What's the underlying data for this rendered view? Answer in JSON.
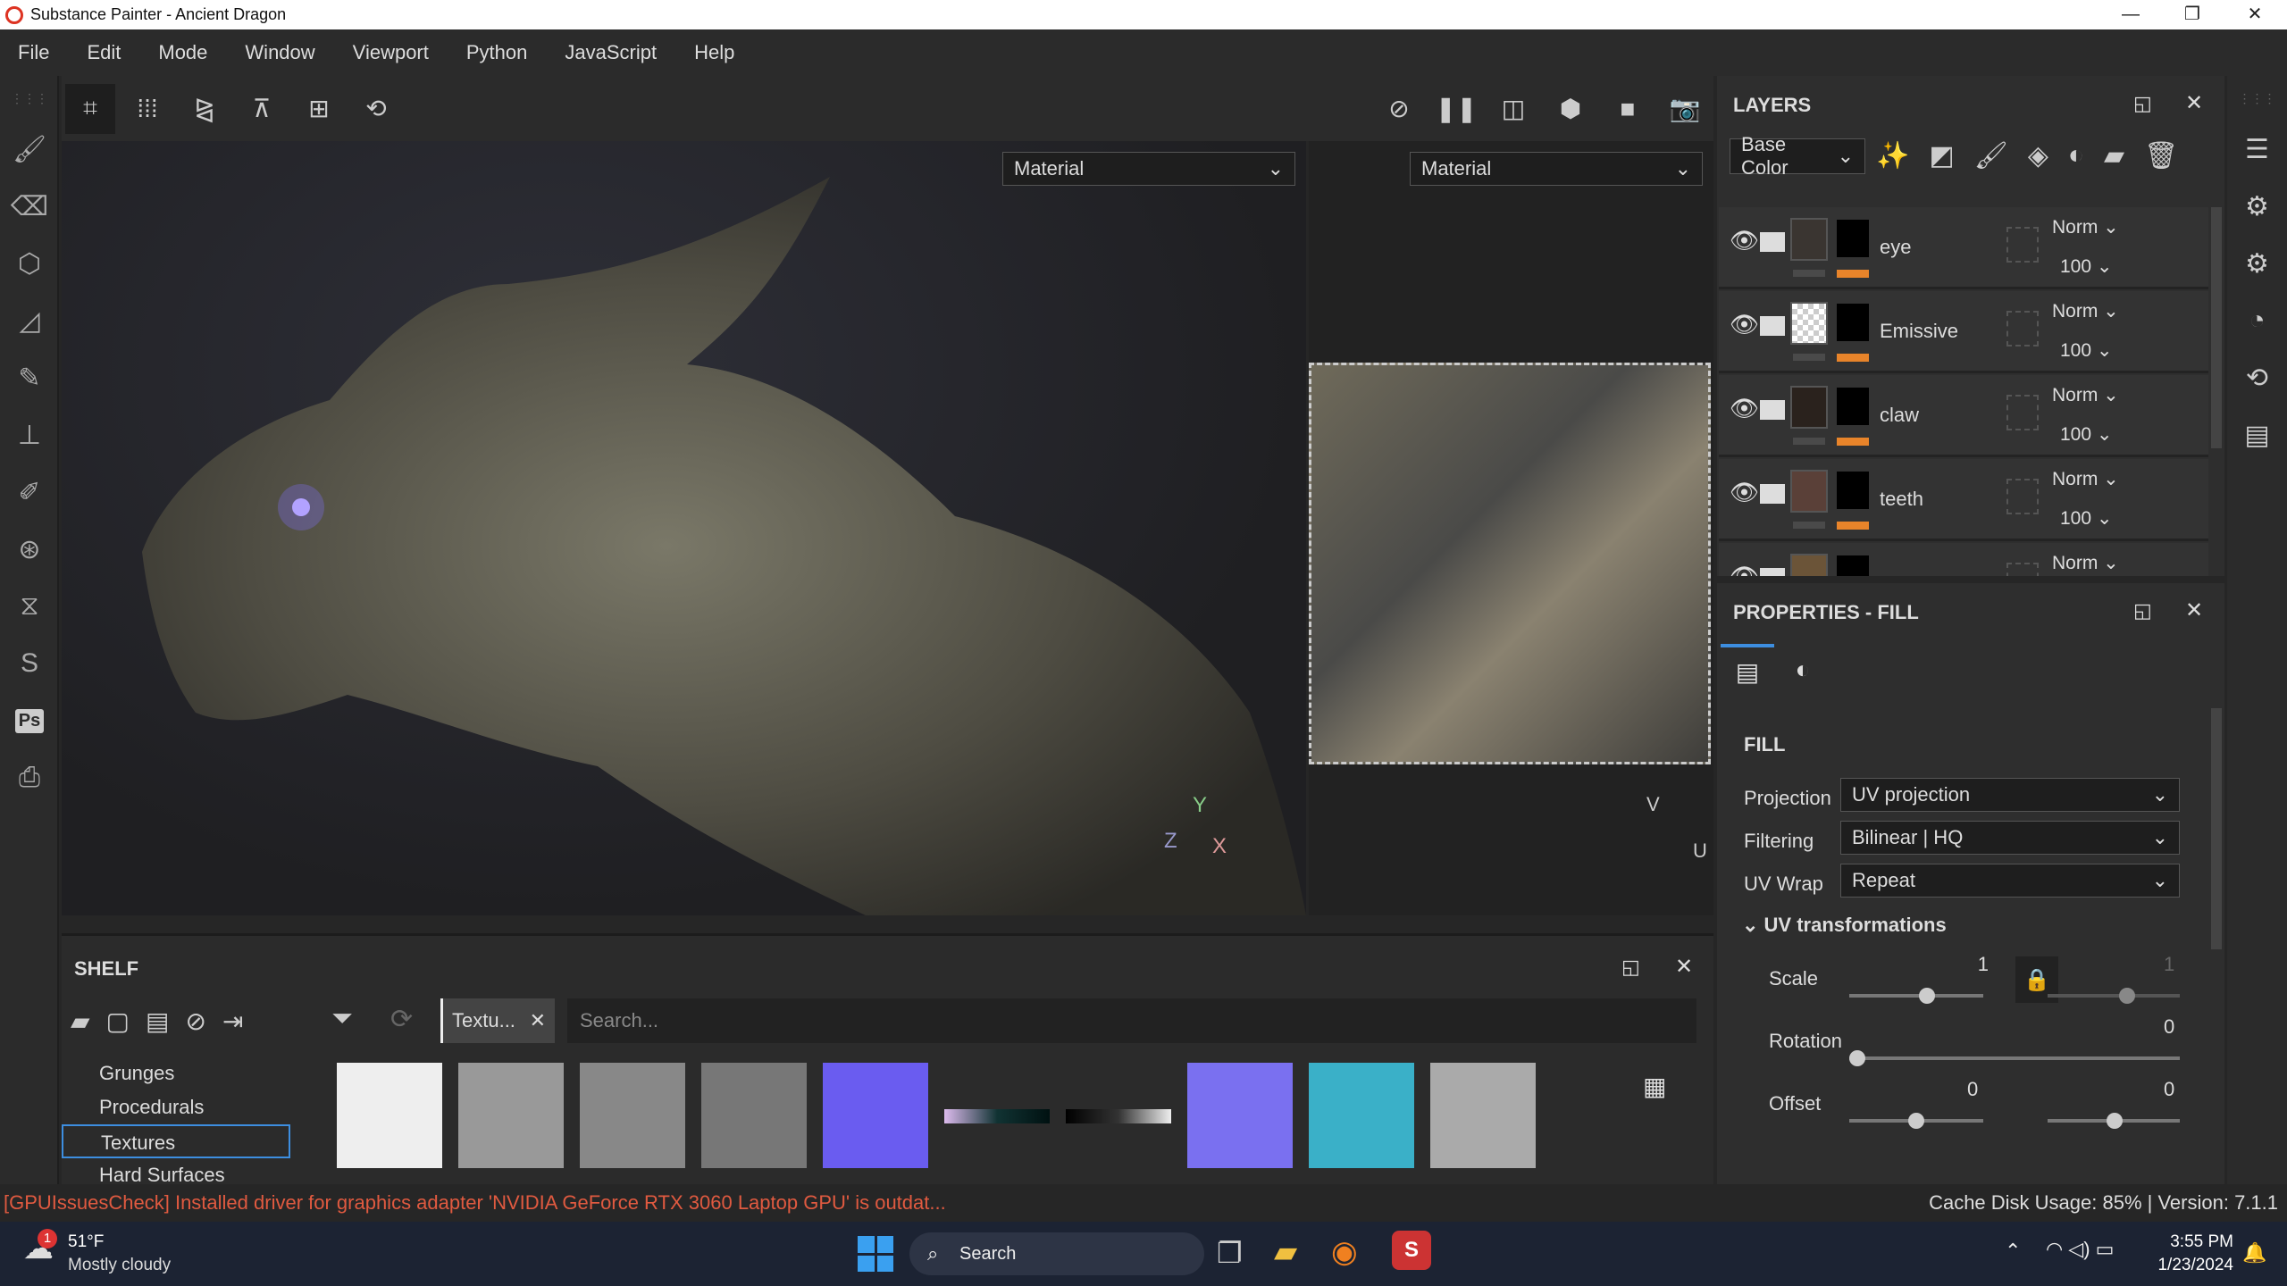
{
  "window": {
    "title": "Substance Painter - Ancient Dragon",
    "minimize": "—",
    "maximize": "❐",
    "close": "✕"
  },
  "menu": [
    "File",
    "Edit",
    "Mode",
    "Window",
    "Viewport",
    "Python",
    "JavaScript",
    "Help"
  ],
  "viewport": {
    "left_mode": "Material",
    "right_mode": "Material",
    "axis_3d": {
      "y": "Y",
      "z": "Z",
      "x": "X"
    },
    "axis_2d": {
      "v": "V",
      "u": "U"
    }
  },
  "shelf": {
    "title": "SHELF",
    "filter_tag": "Textu...",
    "search_placeholder": "Search...",
    "categories": [
      "Grunges",
      "Procedurals",
      "Textures",
      "Hard Surfaces"
    ],
    "selected_category": "Textures",
    "thumbnails": [
      {
        "color": "#eee"
      },
      {
        "color": "#999"
      },
      {
        "color": "#888"
      },
      {
        "color": "#777"
      },
      {
        "color": "#6a5cf0"
      },
      {
        "color": "#133"
      },
      {
        "color": "#ccc"
      },
      {
        "color": "#7a70f0"
      },
      {
        "color": "#3ab0c8"
      },
      {
        "color": "#aaa"
      }
    ]
  },
  "layers": {
    "title": "LAYERS",
    "channel": "Base Color",
    "items": [
      {
        "name": "eye",
        "blend": "Norm",
        "opacity": "100",
        "thumb": "#3a3531"
      },
      {
        "name": "Emissive",
        "blend": "Norm",
        "opacity": "100",
        "thumb": "checker"
      },
      {
        "name": "claw",
        "blend": "Norm",
        "opacity": "100",
        "thumb": "#2a221d"
      },
      {
        "name": "teeth",
        "blend": "Norm",
        "opacity": "100",
        "thumb": "#5a4038"
      },
      {
        "name": "",
        "blend": "Norm",
        "opacity": "",
        "thumb": "#6b5438"
      }
    ]
  },
  "properties": {
    "title": "PROPERTIES - FILL",
    "section": "FILL",
    "projection_label": "Projection",
    "projection": "UV projection",
    "filtering_label": "Filtering",
    "filtering": "Bilinear | HQ",
    "uvwrap_label": "UV Wrap",
    "uvwrap": "Repeat",
    "uvt_label": "UV transformations",
    "scale_label": "Scale",
    "scale_u": "1",
    "scale_v": "1",
    "rotation_label": "Rotation",
    "rotation": "0",
    "offset_label": "Offset",
    "offset_u": "0",
    "offset_v": "0"
  },
  "status": {
    "message": "[GPUIssuesCheck] Installed driver for graphics adapter 'NVIDIA GeForce RTX 3060 Laptop GPU' is outdat...",
    "right": "Cache Disk Usage: 85% | Version: 7.1.1"
  },
  "taskbar": {
    "temp": "51°F",
    "weather": "Mostly cloudy",
    "badge": "1",
    "search": "Search",
    "time": "3:55 PM",
    "date": "1/23/2024"
  },
  "colors": {
    "accent": "#e8842a",
    "selection": "#3d8ee0",
    "error": "#e05a40"
  }
}
